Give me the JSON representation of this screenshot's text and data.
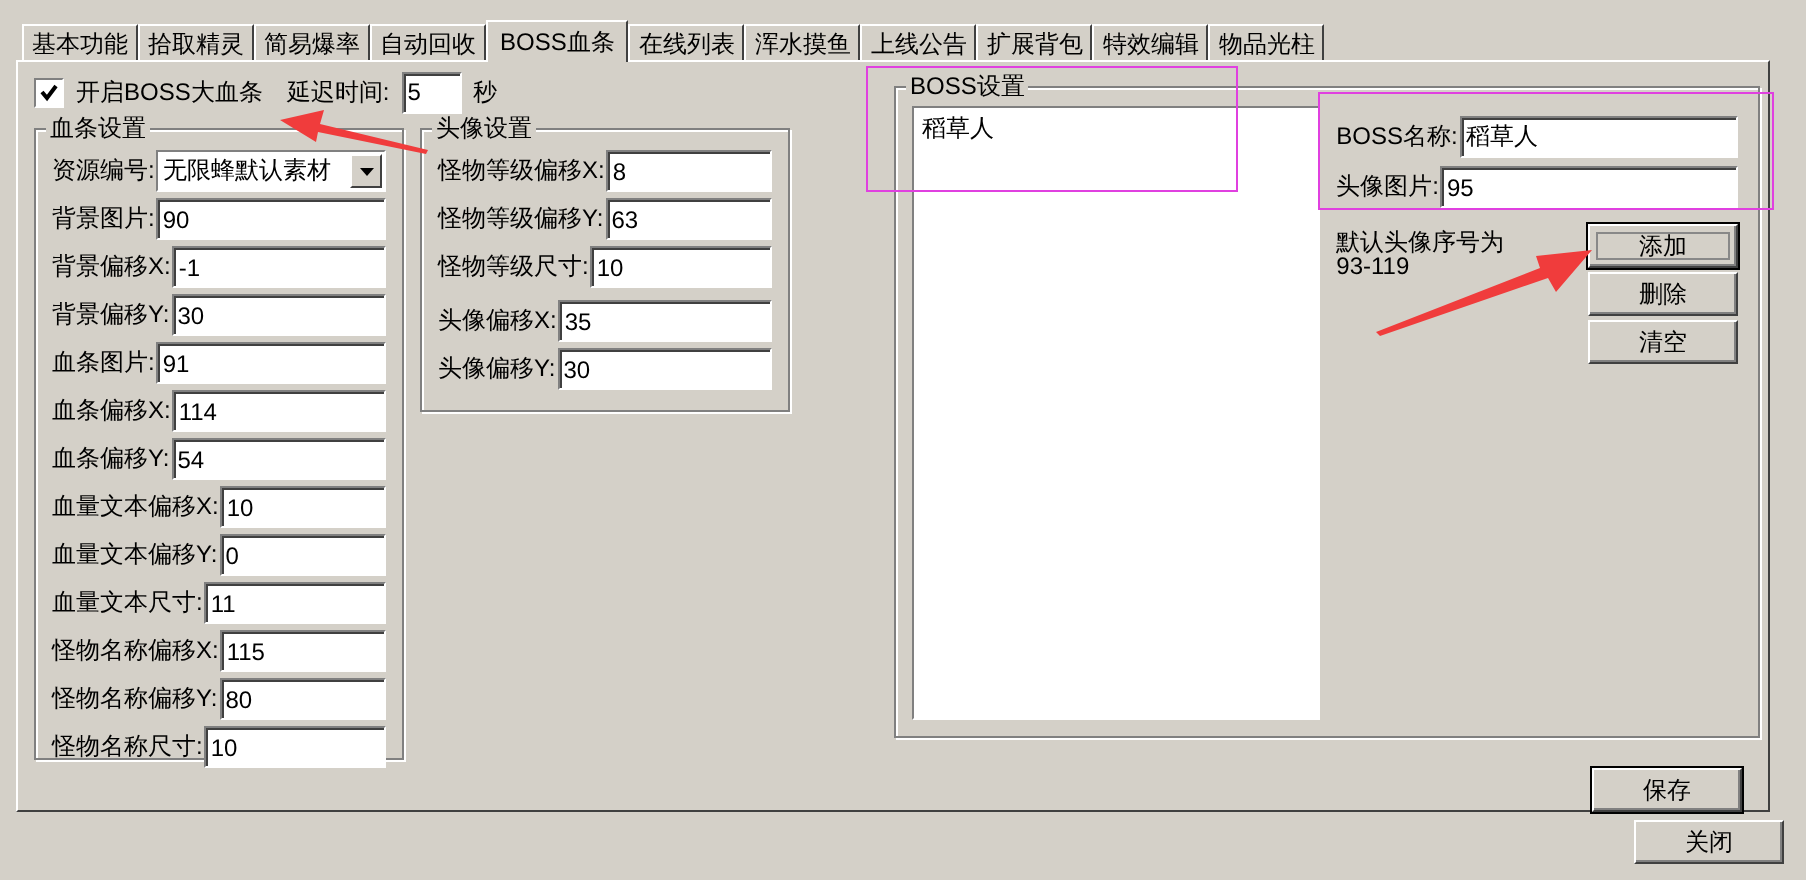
{
  "tabs": [
    {
      "label": "基本功能",
      "selected": false
    },
    {
      "label": "拾取精灵",
      "selected": false
    },
    {
      "label": "简易爆率",
      "selected": false
    },
    {
      "label": "自动回收",
      "selected": false
    },
    {
      "label": "BOSS血条",
      "selected": true
    },
    {
      "label": "在线列表",
      "selected": false
    },
    {
      "label": "浑水摸鱼",
      "selected": false
    },
    {
      "label": "上线公告",
      "selected": false
    },
    {
      "label": "扩展背包",
      "selected": false
    },
    {
      "label": "特效编辑",
      "selected": false
    },
    {
      "label": "物品光柱",
      "selected": false
    }
  ],
  "enable_boss_bar": {
    "label": "开启BOSS大血条",
    "checked": true
  },
  "delay": {
    "label": "延迟时间:",
    "value": "5",
    "unit": "秒"
  },
  "health_bar_settings": {
    "title": "血条设置",
    "fields": [
      {
        "kind": "dropdown",
        "label": "资源编号:",
        "value": "无限蜂默认素材"
      },
      {
        "kind": "text",
        "label": "背景图片:",
        "value": "90"
      },
      {
        "kind": "text",
        "label": "背景偏移X:",
        "value": "-1"
      },
      {
        "kind": "text",
        "label": "背景偏移Y:",
        "value": "30"
      },
      {
        "kind": "text",
        "label": "血条图片:",
        "value": "91"
      },
      {
        "kind": "text",
        "label": "血条偏移X:",
        "value": "114"
      },
      {
        "kind": "text",
        "label": "血条偏移Y:",
        "value": "54"
      },
      {
        "kind": "text",
        "label": "血量文本偏移X:",
        "value": "10"
      },
      {
        "kind": "text",
        "label": "血量文本偏移Y:",
        "value": "0"
      },
      {
        "kind": "text",
        "label": "血量文本尺寸:",
        "value": "11"
      },
      {
        "kind": "text",
        "label": "怪物名称偏移X:",
        "value": "115"
      },
      {
        "kind": "text",
        "label": "怪物名称偏移Y:",
        "value": "80"
      },
      {
        "kind": "text",
        "label": "怪物名称尺寸:",
        "value": "10"
      }
    ]
  },
  "avatar_settings": {
    "title": "头像设置",
    "fields": [
      {
        "label": "怪物等级偏移X:",
        "value": "8"
      },
      {
        "label": "怪物等级偏移Y:",
        "value": "63"
      },
      {
        "label": "怪物等级尺寸:",
        "value": "10"
      },
      {
        "label": "头像偏移X:",
        "value": "35"
      },
      {
        "label": "头像偏移Y:",
        "value": "30"
      }
    ]
  },
  "boss_settings": {
    "title": "BOSS设置",
    "list": [
      {
        "label": "稻草人",
        "selected": false
      }
    ],
    "fields": [
      {
        "label": "BOSS名称:",
        "value": "稻草人"
      },
      {
        "label": "头像图片:",
        "value": "95"
      }
    ],
    "hint": [
      "默认头像序号为",
      "93-119"
    ],
    "buttons": [
      {
        "label": "添加",
        "focused": true
      },
      {
        "label": "删除",
        "focused": false
      },
      {
        "label": "清空",
        "focused": false
      }
    ]
  },
  "save_button": "保存",
  "close_button": "关闭"
}
